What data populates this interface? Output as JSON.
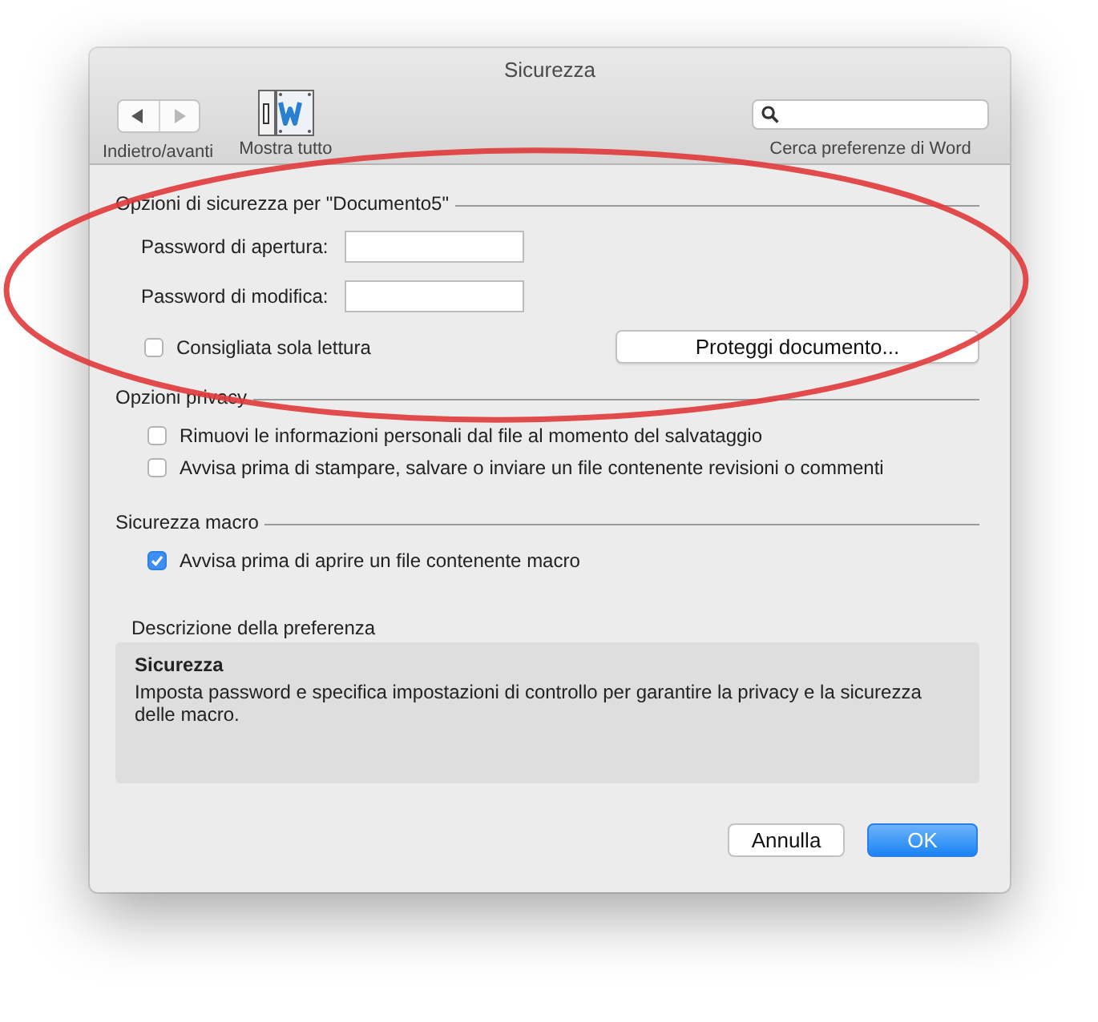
{
  "window": {
    "title": "Sicurezza"
  },
  "toolbar": {
    "nav": {
      "label": "Indietro/avanti",
      "back_disabled": false,
      "forward_disabled": true
    },
    "show_all": {
      "label": "Mostra tutto"
    },
    "search": {
      "label": "Cerca preferenze di Word"
    }
  },
  "sections": [
    {
      "title": "Opzioni di sicurezza per \"Documento5\"",
      "items": [
        {
          "kind": "password",
          "label": "Password di apertura:"
        },
        {
          "kind": "password",
          "label": "Password di modifica:"
        },
        {
          "kind": "checkbox",
          "label": "Consigliata sola lettura",
          "checked": false,
          "button": "Proteggi documento..."
        }
      ]
    },
    {
      "title": "Opzioni privacy",
      "items": [
        {
          "kind": "checkbox",
          "label": "Rimuovi le informazioni personali dal file al momento del salvataggio",
          "checked": false
        },
        {
          "kind": "checkbox",
          "label": "Avvisa prima di stampare, salvare o inviare un file contenente revisioni o commenti",
          "checked": false
        }
      ]
    },
    {
      "title": "Sicurezza macro",
      "items": [
        {
          "kind": "checkbox",
          "label": "Avvisa prima di aprire un file contenente macro",
          "checked": true
        }
      ]
    }
  ],
  "description": {
    "heading": "Descrizione della preferenza",
    "title": "Sicurezza",
    "text": "Imposta password e specifica impostazioni di controllo per garantire la privacy e la sicurezza delle macro."
  },
  "buttons": [
    {
      "label": "Annulla",
      "default": false
    },
    {
      "label": "OK",
      "default": true
    }
  ],
  "annotation": {
    "kind": "ellipse"
  }
}
